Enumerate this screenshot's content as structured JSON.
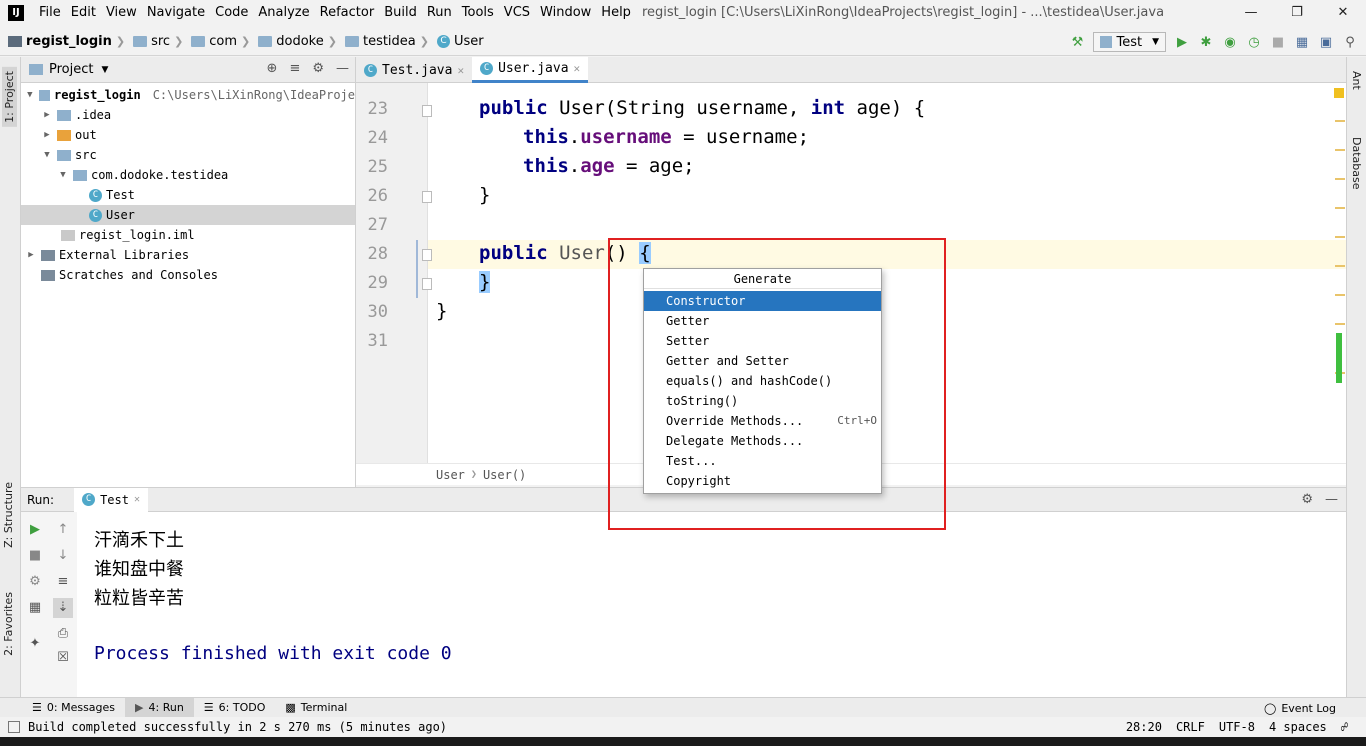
{
  "menubar": {
    "logo": "IJ",
    "items": [
      "File",
      "Edit",
      "View",
      "Navigate",
      "Code",
      "Analyze",
      "Refactor",
      "Build",
      "Run",
      "Tools",
      "VCS",
      "Window",
      "Help"
    ],
    "title": "regist_login [C:\\Users\\LiXinRong\\IdeaProjects\\regist_login] - ...\\testidea\\User.java"
  },
  "navbar": {
    "crumbs": [
      "regist_login",
      "src",
      "com",
      "dodoke",
      "testidea",
      "User"
    ],
    "run_config": "Test"
  },
  "left_stripe": {
    "project": "1: Project",
    "structure": "Z: Structure",
    "favorites": "2: Favorites"
  },
  "right_stripe": {
    "ant": "Ant",
    "database": "Database"
  },
  "project_panel": {
    "title": "Project",
    "tree": [
      {
        "label": "regist_login",
        "hint": "C:\\Users\\LiXinRong\\IdeaProje"
      },
      {
        "label": ".idea"
      },
      {
        "label": "out"
      },
      {
        "label": "src"
      },
      {
        "label": "com.dodoke.testidea"
      },
      {
        "label": "Test"
      },
      {
        "label": "User"
      },
      {
        "label": "regist_login.iml"
      },
      {
        "label": "External Libraries"
      },
      {
        "label": "Scratches and Consoles"
      }
    ]
  },
  "editor": {
    "tabs": [
      "Test.java",
      "User.java"
    ],
    "line_numbers": [
      "23",
      "24",
      "25",
      "26",
      "27",
      "28",
      "29",
      "30",
      "31"
    ],
    "breadcrumb": [
      "User",
      "User()"
    ],
    "code": {
      "l23_kw": "public",
      "l23_cls": "User",
      "l23_rest": "(String username, ",
      "l23_kw2": "int",
      "l23_end": " age) {",
      "l24_kw": "this",
      "l24_fld": "username",
      "l24_rest": " = username;",
      "l25_kw": "this",
      "l25_fld": "age",
      "l25_rest": " = age;",
      "l26": "}",
      "l28_kw": "public",
      "l28_cls": "User",
      "l28_paren": "()",
      "l28_brace": "{",
      "l29_brace": "}",
      "l30": "}"
    }
  },
  "generate_popup": {
    "title": "Generate",
    "items": [
      {
        "label": "Constructor",
        "shortcut": ""
      },
      {
        "label": "Getter",
        "shortcut": ""
      },
      {
        "label": "Setter",
        "shortcut": ""
      },
      {
        "label": "Getter and Setter",
        "shortcut": ""
      },
      {
        "label": "equals() and hashCode()",
        "shortcut": ""
      },
      {
        "label": "toString()",
        "shortcut": ""
      },
      {
        "label": "Override Methods...",
        "shortcut": "Ctrl+O"
      },
      {
        "label": "Delegate Methods...",
        "shortcut": ""
      },
      {
        "label": "Test...",
        "shortcut": ""
      },
      {
        "label": "Copyright",
        "shortcut": ""
      }
    ]
  },
  "run_panel": {
    "label": "Run:",
    "tab": "Test",
    "output": [
      "汗滴禾下土",
      "谁知盘中餐",
      "粒粒皆辛苦"
    ],
    "exit": "Process finished with exit code 0"
  },
  "bottom_tabs": [
    "0: Messages",
    "4: Run",
    "6: TODO",
    "Terminal"
  ],
  "event_log": "Event Log",
  "statusbar": {
    "message": "Build completed successfully in 2 s 270 ms (5 minutes ago)",
    "position": "28:20",
    "line_sep": "CRLF",
    "encoding": "UTF-8",
    "indent": "4 spaces"
  },
  "colors": {
    "accent": "#2675bf",
    "annotation": "#e02020"
  }
}
